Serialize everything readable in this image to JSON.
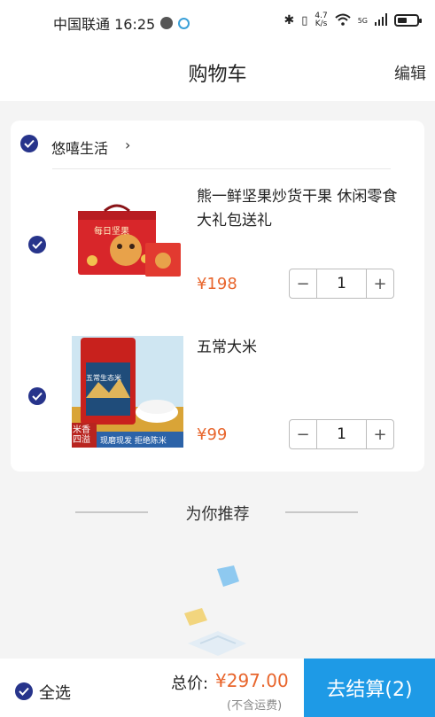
{
  "status_bar": {
    "carrier_time": "中国联通 16:25",
    "speed_value": "4.7",
    "speed_unit": "K/s",
    "net": "5G"
  },
  "header": {
    "title": "购物车",
    "edit_label": "编辑"
  },
  "shop": {
    "name": "悠嘻生活",
    "selected": true
  },
  "items": [
    {
      "title": "熊一鲜坚果炒货干果 休闲零食大礼包送礼",
      "price": "¥198",
      "quantity": "1",
      "selected": true,
      "image_text": "每日坚果"
    },
    {
      "title": "五常大米",
      "price": "¥99",
      "quantity": "1",
      "selected": true,
      "image_text_1": "五常生态米",
      "image_text_2": "米香四溢",
      "image_text_3": "现磨现发 拒绝陈米"
    }
  ],
  "stepper": {
    "minus": "−",
    "plus": "+"
  },
  "recommend": {
    "title": "为你推荐"
  },
  "bottom": {
    "select_all_label": "全选",
    "total_label": "总价:",
    "total_value": "¥297.00",
    "shipping_note": "(不含运费)",
    "checkout_label": "去结算(2)"
  },
  "colors": {
    "accent": "#1e9ae6",
    "check": "#27348b",
    "price": "#e8652c"
  }
}
